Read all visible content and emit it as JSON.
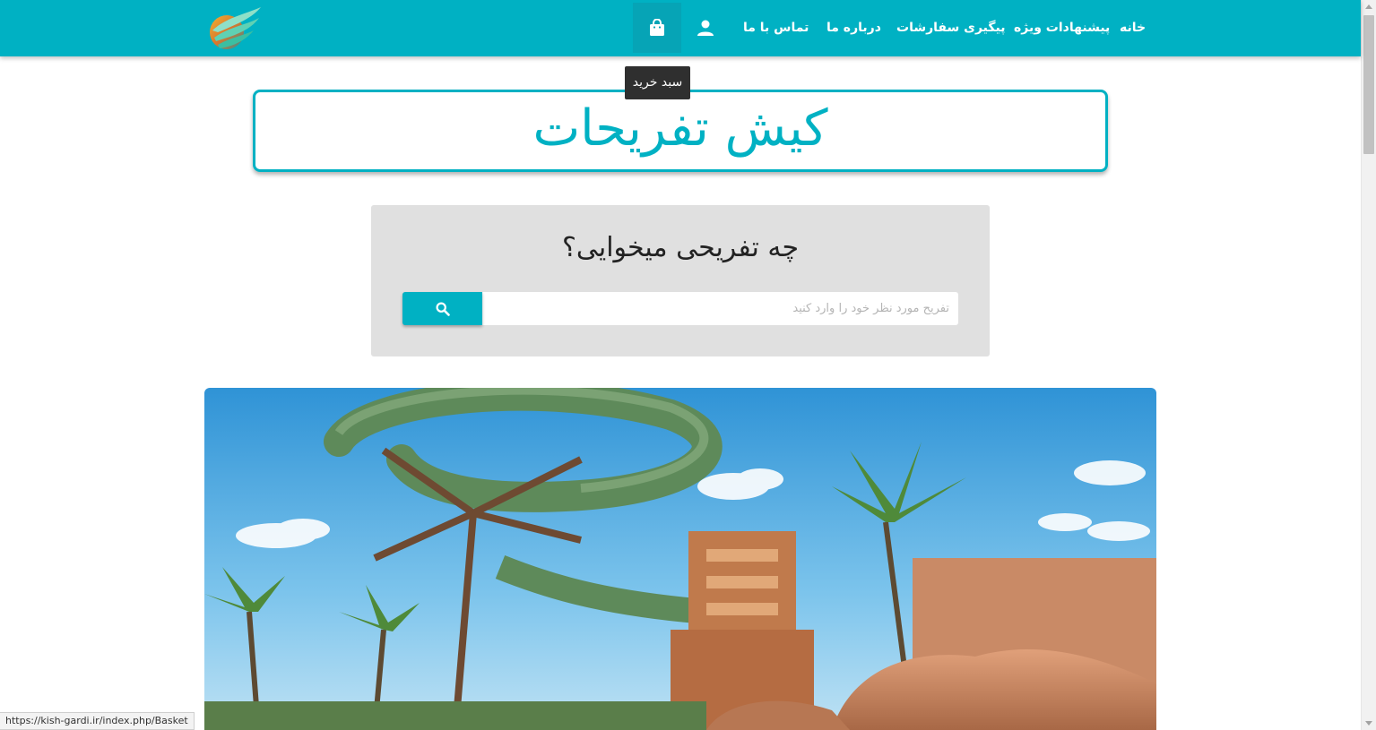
{
  "navbar": {
    "logo_icon": "feather-wing-logo-icon",
    "items": [
      {
        "label": "خانه"
      },
      {
        "label": "پیشنهادات ویژه"
      },
      {
        "label": "پیگیری سفارشات"
      },
      {
        "label": "درباره ما"
      },
      {
        "label": "تماس با ما"
      }
    ],
    "user_icon": "user-icon",
    "cart_icon": "shopping-bag-icon",
    "cart_tooltip": "سبد خرید"
  },
  "title": "کیش تفریحات",
  "search": {
    "question": "چه تفریحی میخوایی؟",
    "placeholder": "تفریح مورد نظر خود را وارد کنید",
    "value": "",
    "button_icon": "search-icon"
  },
  "hero": {
    "image": "water-slide-park-photo"
  },
  "statusbar": {
    "url": "https://kish-gardi.ir/index.php/Basket"
  },
  "colors": {
    "brand": "#00b1c3",
    "panel": "#e0e0e0",
    "tooltip": "#2f2f2f"
  }
}
